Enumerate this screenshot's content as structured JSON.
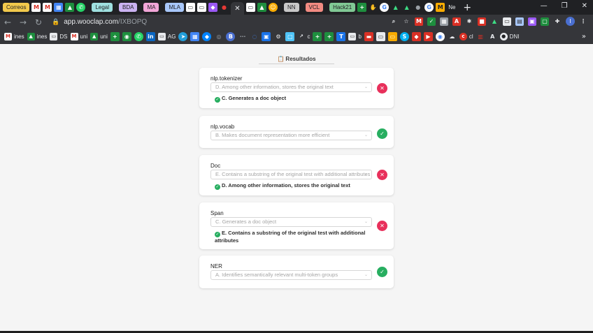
{
  "tabs": {
    "pills": [
      {
        "label": "Correos",
        "bg": "#f2c94c"
      },
      {
        "label": "Legal",
        "bg": "#9fe0e0"
      },
      {
        "label": "BDA",
        "bg": "#cbb3f2"
      },
      {
        "label": "MA",
        "bg": "#f2a6d8"
      },
      {
        "label": "MLA",
        "bg": "#a8c7fa"
      },
      {
        "label": "NN",
        "bg": "#c8c8c8"
      },
      {
        "label": "VCL",
        "bg": "#f28b82"
      },
      {
        "label": "Hack21",
        "bg": "#81c995"
      }
    ],
    "last_tab_label": "Ne",
    "new_tab_label": "+"
  },
  "window_controls": {
    "minimize": "—",
    "restore": "❐",
    "close": "✕"
  },
  "toolbar": {
    "back": "←",
    "forward": "→",
    "reload": "↻",
    "lock": "🔒",
    "url_host": "app.wooclap.com",
    "url_path": "/IXBOPQ",
    "profile_initial": "I"
  },
  "bookmarks": [
    {
      "icon": "M",
      "color": "#d93025",
      "label": "ines"
    },
    {
      "icon": "▲",
      "color": "#1e8e3e",
      "label": "ines"
    },
    {
      "icon": "▭",
      "color": "#5f6368",
      "label": "DS"
    },
    {
      "icon": "M",
      "color": "#d93025",
      "label": "uni"
    },
    {
      "icon": "▲",
      "color": "#1e8e3e",
      "label": "uni"
    },
    {
      "icon": "▭",
      "color": "#5f6368",
      "label": "AG"
    },
    {
      "icon": "c",
      "color": "#0b57d0",
      "label": "c"
    },
    {
      "icon": "b",
      "color": "#5f6368",
      "label": "b"
    },
    {
      "icon": "c",
      "color": "#d93025",
      "label": "cl"
    },
    {
      "icon": "●",
      "color": "#e8eaed",
      "label": "DNI"
    }
  ],
  "bookmarks_more": "»",
  "page": {
    "title_icon": "📋",
    "title": "Resultados"
  },
  "questions": [
    {
      "label": "nlp.tokenizer",
      "answer": "D. Among other information, stores the original text",
      "correct": "C. Generates a doc object",
      "status": "wrong",
      "status_symbol": "✕"
    },
    {
      "label": "nlp.vocab",
      "answer": "B. Makes document representation more efficient",
      "correct": "",
      "status": "right",
      "status_symbol": "✓"
    },
    {
      "label": "Doc",
      "answer": "E. Contains a substring of the original test with additional attributes",
      "correct": "D. Among other information, stores the original text",
      "status": "wrong",
      "status_symbol": "✕"
    },
    {
      "label": "Span",
      "answer": "C. Generates a doc object",
      "correct": "E. Contains a substring of the original test with additional attributes",
      "status": "wrong",
      "status_symbol": "✕"
    },
    {
      "label": "NER",
      "answer": "A. Identifies semantically relevant multi-token groups",
      "correct": "",
      "status": "right",
      "status_symbol": "✓"
    }
  ],
  "icons": {
    "caret": "⌄",
    "check": "✓"
  },
  "colors": {
    "wrong": "#e8305b",
    "right": "#27ae60"
  }
}
